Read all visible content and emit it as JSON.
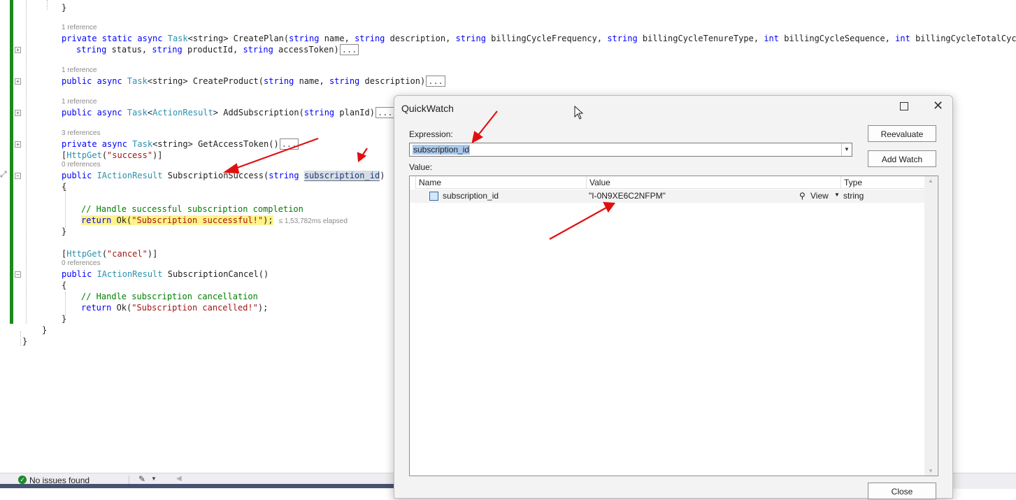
{
  "editor": {
    "refs": [
      "1 reference",
      "1 reference",
      "1 reference",
      "3 references",
      "0 references",
      "0 references"
    ],
    "collapsed_marker": "...",
    "elapsed": "≤ 1,53,782ms elapsed",
    "lines": {
      "l0": "}",
      "l1_a": "private static async ",
      "l1_b": "Task",
      "l1_c": "<string> CreatePlan(",
      "l1_d": "string",
      "l1_e": " name, ",
      "l1_f": "string",
      "l1_g": " description, ",
      "l1_h": "string",
      "l1_i": " billingCycleFrequency, ",
      "l1_j": "string",
      "l1_k": " billingCycleTenureType, ",
      "l1_l": "int",
      "l1_m": " billingCycleSequence, ",
      "l1_n": "int",
      "l1_o": " billingCycleTotalCycles, s",
      "l2_a": "string",
      "l2_b": " status, ",
      "l2_c": "string",
      "l2_d": " productId, ",
      "l2_e": "string",
      "l2_f": " accessToken)",
      "l3_a": "public async ",
      "l3_b": "Task",
      "l3_c": "<string> CreateProduct(",
      "l3_d": "string",
      "l3_e": " name, ",
      "l3_f": "string",
      "l3_g": " description)",
      "l4_a": "public async ",
      "l4_b": "Task",
      "l4_c": "<",
      "l4_d": "ActionResult",
      "l4_e": "> AddSubscription(",
      "l4_f": "string",
      "l4_g": " planId)",
      "l5_a": "private async ",
      "l5_b": "Task",
      "l5_c": "<string> GetAccessToken()",
      "l6_a": "[",
      "l6_b": "HttpGet",
      "l6_c": "(",
      "l6_d": "\"success\"",
      "l6_e": ")]",
      "l7_a": "public ",
      "l7_b": "IActionResult",
      "l7_c": " SubscriptionSuccess(",
      "l7_d": "string",
      "l7_e": " ",
      "l7_f": "subscription_id",
      "l7_g": ")",
      "l8": "{",
      "l9": "// Handle successful subscription completion",
      "l10_a": "return",
      "l10_b": " Ok(",
      "l10_c": "\"Subscription successful!\"",
      "l10_d": ");",
      "l11": "}",
      "l12_a": "[",
      "l12_b": "HttpGet",
      "l12_c": "(",
      "l12_d": "\"cancel\"",
      "l12_e": ")]",
      "l13_a": "public ",
      "l13_b": "IActionResult",
      "l13_c": " SubscriptionCancel()",
      "l14": "{",
      "l15": "// Handle subscription cancellation",
      "l16_a": "return",
      "l16_b": " Ok(",
      "l16_c": "\"Subscription cancelled!\"",
      "l16_d": ");",
      "l17": "}",
      "l18": "}",
      "l19": "}"
    }
  },
  "quickwatch": {
    "title": "QuickWatch",
    "expression_label": "Expression:",
    "expression_value": "subscription_id",
    "value_label": "Value:",
    "reevaluate": "Reevaluate",
    "add_watch": "Add Watch",
    "close": "Close",
    "columns": [
      "Name",
      "Value",
      "Type"
    ],
    "row": {
      "name": "subscription_id",
      "value": "\"I-0N9XE6C2NFPM\"",
      "view": "View",
      "type": "string"
    }
  },
  "status": {
    "message": "No issues found"
  },
  "colors": {
    "annotation_arrow": "#e01010",
    "change_bar": "#1a8a1a",
    "status_ok": "#1c8c2c"
  }
}
